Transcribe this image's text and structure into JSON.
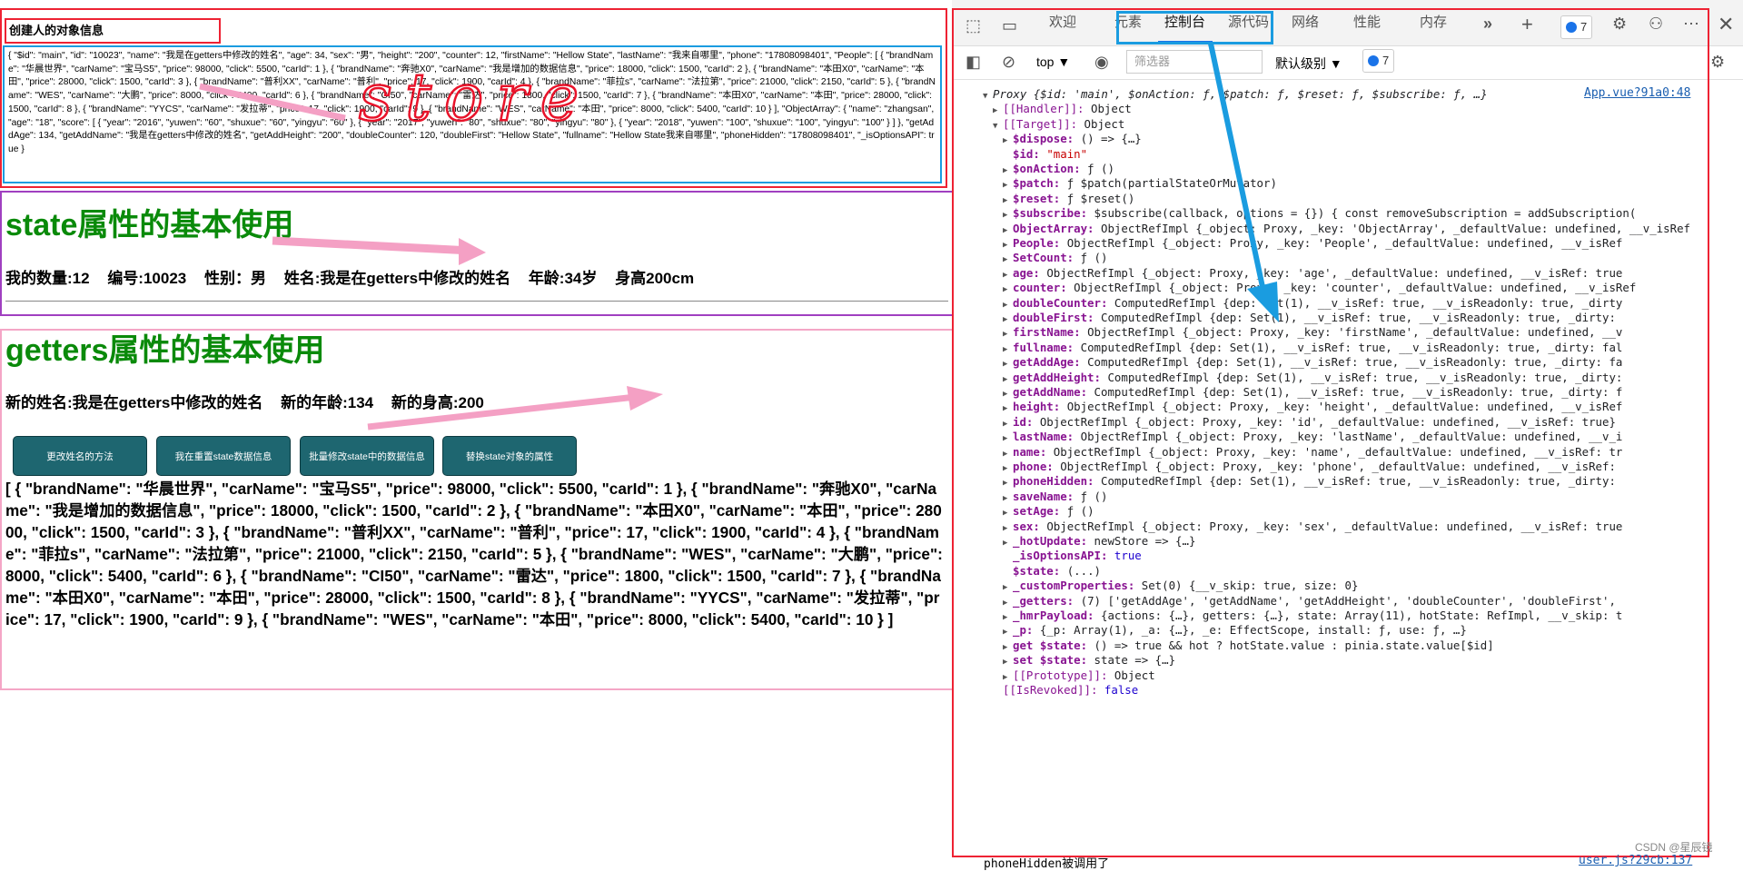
{
  "app": {
    "store_title": "创建人的对象信息",
    "store_json": "{ \"$id\": \"main\", \"id\": \"10023\", \"name\": \"我是在getters中修改的姓名\", \"age\": 34, \"sex\": \"男\", \"height\": \"200\", \"counter\": 12, \"firstName\": \"Hellow State\", \"lastName\": \"我来自哪里\", \"phone\": \"17808098401\", \"People\": [ { \"brandName\": \"华晨世界\", \"carName\": \"宝马S5\", \"price\": 98000, \"click\": 5500, \"carId\": 1 }, { \"brandName\": \"奔驰X0\", \"carName\": \"我是增加的数据信息\", \"price\": 18000, \"click\": 1500, \"carId\": 2 }, { \"brandName\": \"本田X0\", \"carName\": \"本田\", \"price\": 28000, \"click\": 1500, \"carId\": 3 }, { \"brandName\": \"普利XX\", \"carName\": \"普利\", \"price\": 17, \"click\": 1900, \"carId\": 4 }, { \"brandName\": \"菲拉s\", \"carName\": \"法拉第\", \"price\": 21000, \"click\": 2150, \"carId\": 5 }, { \"brandName\": \"WES\", \"carName\": \"大鹏\", \"price\": 8000, \"click\": 5400, \"carId\": 6 }, { \"brandName\": \"CI50\", \"carName\": \"雷达\", \"price\": 1800, \"click\": 1500, \"carId\": 7 }, { \"brandName\": \"本田X0\", \"carName\": \"本田\", \"price\": 28000, \"click\": 1500, \"carId\": 8 }, { \"brandName\": \"YYCS\", \"carName\": \"发拉蒂\", \"price\": 17, \"click\": 1900, \"carId\": 9 }, { \"brandName\": \"WES\", \"carName\": \"本田\", \"price\": 8000, \"click\": 5400, \"carId\": 10 } ], \"ObjectArray\": { \"name\": \"zhangsan\", \"age\": \"18\", \"score\": [ { \"year\": \"2016\", \"yuwen\": \"60\", \"shuxue\": \"60\", \"yingyu\": \"60\" }, { \"year\": \"2017\", \"yuwen\": \"80\", \"shuxue\": \"80\", \"yingyu\": \"80\" }, { \"year\": \"2018\", \"yuwen\": \"100\", \"shuxue\": \"100\", \"yingyu\": \"100\" } ] }, \"getAddAge\": 134, \"getAddName\": \"我是在getters中修改的姓名\", \"getAddHeight\": \"200\", \"doubleCounter\": 120, \"doubleFirst\": \"Hellow State\", \"fullname\": \"Hellow State我来自哪里\", \"phoneHidden\": \"17808098401\", \"_isOptionsAPI\": true }",
    "state_heading": "state属性的基本使用",
    "state_fields": [
      "我的数量:12",
      "编号:10023",
      "性别：男",
      "姓名:我是在getters中修改的姓名",
      "年龄:34岁",
      "身高200cm"
    ],
    "getters_heading": "getters属性的基本使用",
    "getters_fields": [
      "新的姓名:我是在getters中修改的姓名",
      "新的年龄:134",
      "新的身高:200"
    ],
    "buttons": [
      "更改姓名的方法",
      "我在重置state数据信息",
      "批量修改state中的数据信息",
      "替换state对象的属性"
    ],
    "cars_text": "[ { \"brandName\": \"华晨世界\", \"carName\": \"宝马S5\", \"price\": 98000, \"click\": 5500, \"carId\": 1 }, { \"brandName\": \"奔驰X0\", \"carName\": \"我是增加的数据信息\", \"price\": 18000, \"click\": 1500, \"carId\": 2 }, { \"brandName\": \"本田X0\", \"carName\": \"本田\", \"price\": 28000, \"click\": 1500, \"carId\": 3 }, { \"brandName\": \"普利XX\", \"carName\": \"普利\", \"price\": 17, \"click\": 1900, \"carId\": 4 }, { \"brandName\": \"菲拉s\", \"carName\": \"法拉第\", \"price\": 21000, \"click\": 2150, \"carId\": 5 }, { \"brandName\": \"WES\", \"carName\": \"大鹏\", \"price\": 8000, \"click\": 5400, \"carId\": 6 }, { \"brandName\": \"CI50\", \"carName\": \"雷达\", \"price\": 1800, \"click\": 1500, \"carId\": 7 }, { \"brandName\": \"本田X0\", \"carName\": \"本田\", \"price\": 28000, \"click\": 1500, \"carId\": 8 }, { \"brandName\": \"YYCS\", \"carName\": \"发拉蒂\", \"price\": 17, \"click\": 1900, \"carId\": 9 }, { \"brandName\": \"WES\", \"carName\": \"本田\", \"price\": 8000, \"click\": 5400, \"carId\": 10 } ]",
    "handwriting": "store"
  },
  "devtools": {
    "tabs": [
      "欢迎",
      "元素",
      "控制台",
      "源代码",
      "网络",
      "性能",
      "内存"
    ],
    "active_tab": "控制台",
    "issues_count": "7",
    "context": "top",
    "filter_placeholder": "筛选器",
    "level": "默认级别",
    "console_issues": "7",
    "source_link": "App.vue?91a0:48",
    "footer_text": "phoneHidden被调用了",
    "footer_link": "user.js?29cb:137",
    "watermark": "CSDN @星辰镜",
    "accent": "#1a73e8"
  },
  "console_lines": [
    {
      "indent": 0,
      "arrow": "▼",
      "key": "",
      "val": "Proxy {$id: 'main', $onAction: ƒ, $patch: ƒ, $reset: ƒ, $subscribe: ƒ, …}",
      "italic": true
    },
    {
      "indent": 1,
      "arrow": "▶",
      "key": "[[Handler]]",
      "val": "Object"
    },
    {
      "indent": 1,
      "arrow": "▼",
      "key": "[[Target]]",
      "val": "Object"
    },
    {
      "indent": 2,
      "arrow": "▶",
      "key": "$dispose",
      "val": "() => {…}"
    },
    {
      "indent": 2,
      "arrow": "",
      "key": "$id",
      "val": "\"main\"",
      "str": true
    },
    {
      "indent": 2,
      "arrow": "▶",
      "key": "$onAction",
      "val": "ƒ ()"
    },
    {
      "indent": 2,
      "arrow": "▶",
      "key": "$patch",
      "val": "ƒ $patch(partialStateOrMutator)"
    },
    {
      "indent": 2,
      "arrow": "▶",
      "key": "$reset",
      "val": "ƒ $reset()"
    },
    {
      "indent": 2,
      "arrow": "▶",
      "key": "$subscribe",
      "val": "$subscribe(callback, options = {}) { const removeSubscription = addSubscription("
    },
    {
      "indent": 2,
      "arrow": "▶",
      "key": "ObjectArray",
      "val": "ObjectRefImpl {_object: Proxy, _key: 'ObjectArray', _defaultValue: undefined, __v_isRef"
    },
    {
      "indent": 2,
      "arrow": "▶",
      "key": "People",
      "val": "ObjectRefImpl {_object: Proxy, _key: 'People', _defaultValue: undefined, __v_isRef"
    },
    {
      "indent": 2,
      "arrow": "▶",
      "key": "SetCount",
      "val": "ƒ ()"
    },
    {
      "indent": 2,
      "arrow": "▶",
      "key": "age",
      "val": "ObjectRefImpl {_object: Proxy, _key: 'age', _defaultValue: undefined, __v_isRef: true"
    },
    {
      "indent": 2,
      "arrow": "▶",
      "key": "counter",
      "val": "ObjectRefImpl {_object: Proxy, _key: 'counter', _defaultValue: undefined, __v_isRef"
    },
    {
      "indent": 2,
      "arrow": "▶",
      "key": "doubleCounter",
      "val": "ComputedRefImpl {dep: Set(1), __v_isRef: true, __v_isReadonly: true, _dirty"
    },
    {
      "indent": 2,
      "arrow": "▶",
      "key": "doubleFirst",
      "val": "ComputedRefImpl {dep: Set(1), __v_isRef: true, __v_isReadonly: true, _dirty: "
    },
    {
      "indent": 2,
      "arrow": "▶",
      "key": "firstName",
      "val": "ObjectRefImpl {_object: Proxy, _key: 'firstName', _defaultValue: undefined, __v"
    },
    {
      "indent": 2,
      "arrow": "▶",
      "key": "fullname",
      "val": "ComputedRefImpl {dep: Set(1), __v_isRef: true, __v_isReadonly: true, _dirty: fal"
    },
    {
      "indent": 2,
      "arrow": "▶",
      "key": "getAddAge",
      "val": "ComputedRefImpl {dep: Set(1), __v_isRef: true, __v_isReadonly: true, _dirty: fa"
    },
    {
      "indent": 2,
      "arrow": "▶",
      "key": "getAddHeight",
      "val": "ComputedRefImpl {dep: Set(1), __v_isRef: true, __v_isReadonly: true, _dirty:"
    },
    {
      "indent": 2,
      "arrow": "▶",
      "key": "getAddName",
      "val": "ComputedRefImpl {dep: Set(1), __v_isRef: true, __v_isReadonly: true, _dirty: f"
    },
    {
      "indent": 2,
      "arrow": "▶",
      "key": "height",
      "val": "ObjectRefImpl {_object: Proxy, _key: 'height', _defaultValue: undefined, __v_isRef"
    },
    {
      "indent": 2,
      "arrow": "▶",
      "key": "id",
      "val": "ObjectRefImpl {_object: Proxy, _key: 'id', _defaultValue: undefined, __v_isRef: true}"
    },
    {
      "indent": 2,
      "arrow": "▶",
      "key": "lastName",
      "val": "ObjectRefImpl {_object: Proxy, _key: 'lastName', _defaultValue: undefined, __v_i"
    },
    {
      "indent": 2,
      "arrow": "▶",
      "key": "name",
      "val": "ObjectRefImpl {_object: Proxy, _key: 'name', _defaultValue: undefined, __v_isRef: tr"
    },
    {
      "indent": 2,
      "arrow": "▶",
      "key": "phone",
      "val": "ObjectRefImpl {_object: Proxy, _key: 'phone', _defaultValue: undefined, __v_isRef:"
    },
    {
      "indent": 2,
      "arrow": "▶",
      "key": "phoneHidden",
      "val": "ComputedRefImpl {dep: Set(1), __v_isRef: true, __v_isReadonly: true, _dirty: "
    },
    {
      "indent": 2,
      "arrow": "▶",
      "key": "saveName",
      "val": "ƒ ()"
    },
    {
      "indent": 2,
      "arrow": "▶",
      "key": "setAge",
      "val": "ƒ ()"
    },
    {
      "indent": 2,
      "arrow": "▶",
      "key": "sex",
      "val": "ObjectRefImpl {_object: Proxy, _key: 'sex', _defaultValue: undefined, __v_isRef: true"
    },
    {
      "indent": 2,
      "arrow": "▶",
      "key": "_hotUpdate",
      "val": "newStore => {…}"
    },
    {
      "indent": 2,
      "arrow": "",
      "key": "_isOptionsAPI",
      "val": "true",
      "num": true
    },
    {
      "indent": 2,
      "arrow": "",
      "key": "$state",
      "val": "(...)"
    },
    {
      "indent": 2,
      "arrow": "▶",
      "key": "_customProperties",
      "val": "Set(0) {__v_skip: true, size: 0}"
    },
    {
      "indent": 2,
      "arrow": "▶",
      "key": "_getters",
      "val": "(7) ['getAddAge', 'getAddName', 'getAddHeight', 'doubleCounter', 'doubleFirst',"
    },
    {
      "indent": 2,
      "arrow": "▶",
      "key": "_hmrPayload",
      "val": "{actions: {…}, getters: {…}, state: Array(11), hotState: RefImpl, __v_skip: t"
    },
    {
      "indent": 2,
      "arrow": "▶",
      "key": "_p",
      "val": "{_p: Array(1), _a: {…}, _e: EffectScope, install: ƒ, use: ƒ, …}"
    },
    {
      "indent": 2,
      "arrow": "▶",
      "key": "get $state",
      "val": "() => true && hot ? hotState.value : pinia.state.value[$id]"
    },
    {
      "indent": 2,
      "arrow": "▶",
      "key": "set $state",
      "val": "state => {…}"
    },
    {
      "indent": 2,
      "arrow": "▶",
      "key": "[[Prototype]]",
      "val": "Object"
    },
    {
      "indent": 1,
      "arrow": "",
      "key": "[[IsRevoked]]",
      "val": "false",
      "num": true
    }
  ]
}
